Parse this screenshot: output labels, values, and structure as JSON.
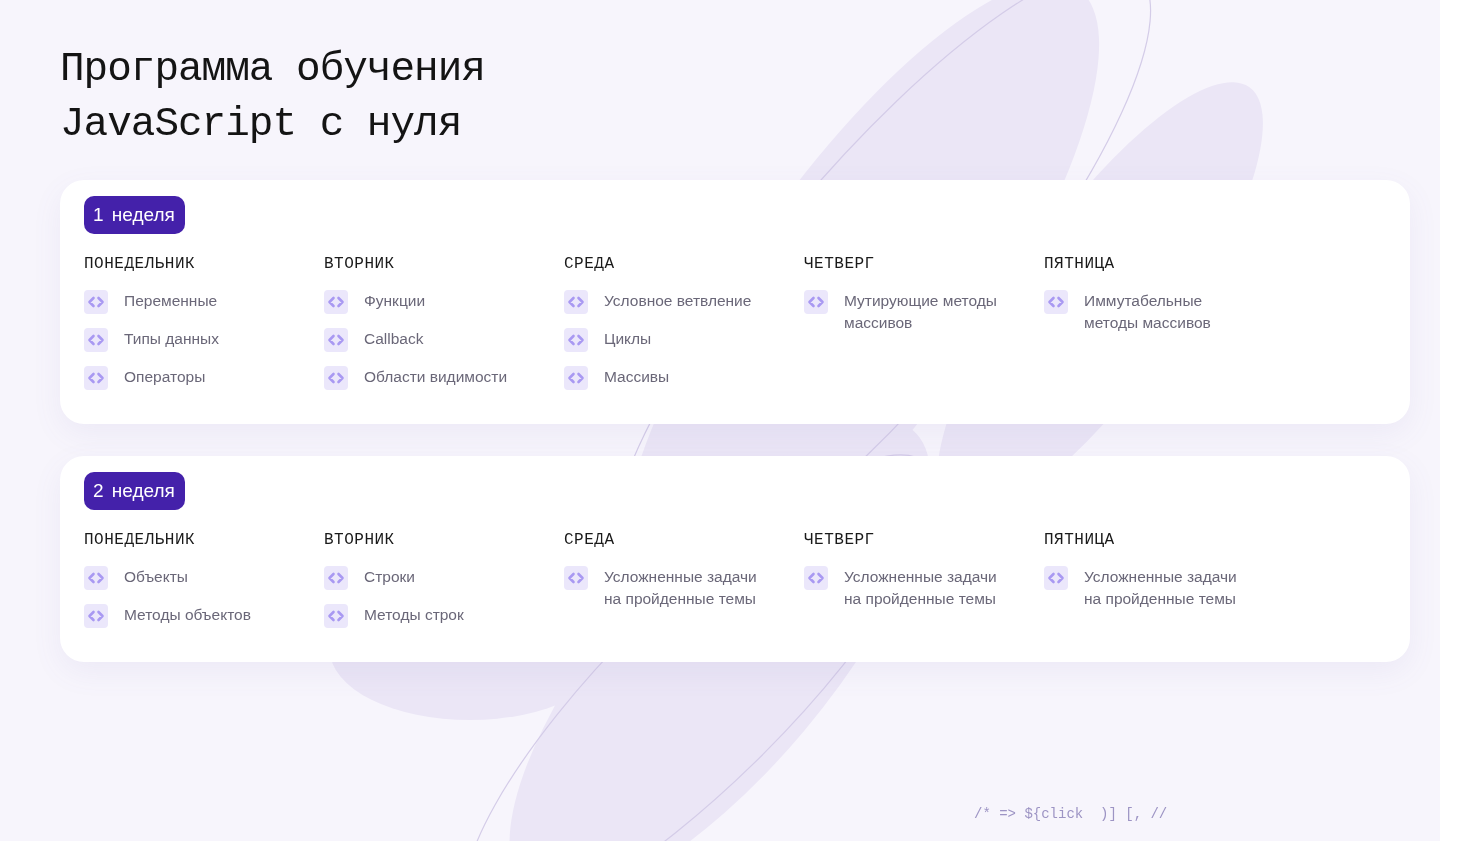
{
  "title": [
    "Программа обучения",
    "JavaScript с нуля"
  ],
  "weeks": [
    {
      "badge": "1 неделя",
      "days": [
        {
          "name": "ПОНЕДЕЛЬНИК",
          "topics": [
            "Переменные",
            "Типы данных",
            "Операторы"
          ]
        },
        {
          "name": "ВТОРНИК",
          "topics": [
            "Функции",
            "Callback",
            "Области видимости"
          ]
        },
        {
          "name": "СРЕДА",
          "topics": [
            "Условное ветвление",
            "Циклы",
            "Массивы"
          ]
        },
        {
          "name": "ЧЕТВЕРГ",
          "topics": [
            "Мутирующие методы массивов"
          ]
        },
        {
          "name": "ПЯТНИЦА",
          "topics": [
            "Иммутабельные методы массивов"
          ]
        }
      ]
    },
    {
      "badge": "2 неделя",
      "days": [
        {
          "name": "ПОНЕДЕЛЬНИК",
          "topics": [
            "Объекты",
            "Методы объектов"
          ]
        },
        {
          "name": "ВТОРНИК",
          "topics": [
            "Строки",
            "Методы строк"
          ]
        },
        {
          "name": "СРЕДА",
          "topics": [
            "Усложненные задачи на пройденные темы"
          ]
        },
        {
          "name": "ЧЕТВЕРГ",
          "topics": [
            "Усложненные задачи на пройденные темы"
          ]
        },
        {
          "name": "ПЯТНИЦА",
          "topics": [
            "Усложненные задачи на пройденные темы"
          ]
        }
      ]
    }
  ],
  "code_decoration": "/* => ${click  )] [, //"
}
